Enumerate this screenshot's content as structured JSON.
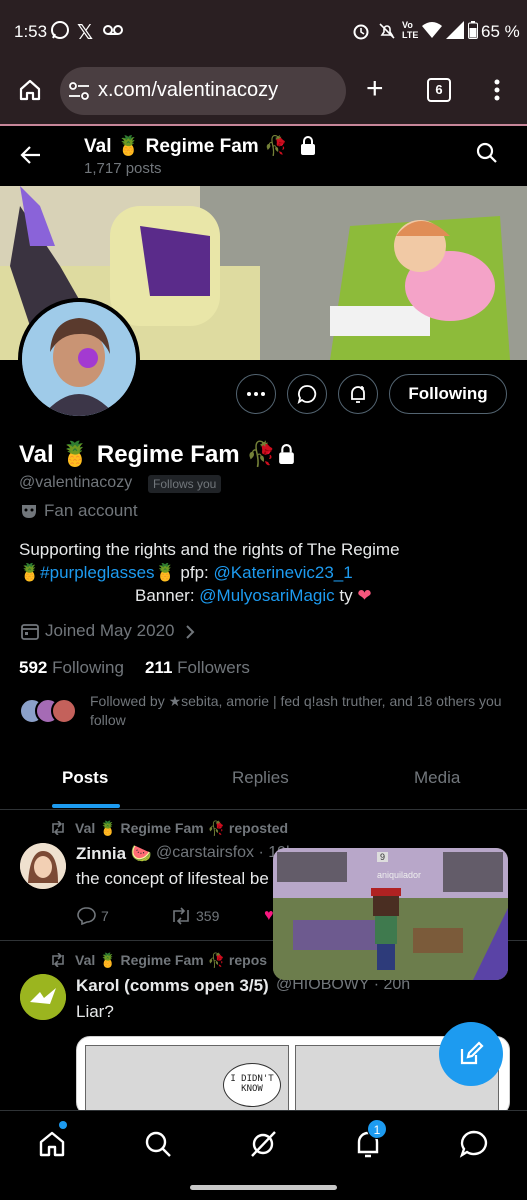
{
  "status": {
    "time": "1:53",
    "battery": "65 %",
    "volte": "Vo LTE"
  },
  "browser": {
    "url": "x.com/valentinacozy",
    "tab_count": "6"
  },
  "header": {
    "name": "Val 🍍 Regime Fam 🥀",
    "posts": "1,717 posts"
  },
  "profile": {
    "name": "Val 🍍 Regime Fam 🥀",
    "handle": "@valentinacozy",
    "follows_you": "Follows you",
    "account_type": "Fan account",
    "bio_line1": "Supporting the rights and the rights of The Regime",
    "bio_hashtag": "#purpleglasses",
    "bio_pfp": "pfp:",
    "bio_pfp_handle": "@Katerinevic23_1",
    "bio_banner": "Banner:",
    "bio_banner_handle": "@MulyosariMagic",
    "bio_ty": "ty",
    "joined": "Joined May 2020",
    "following_count": "592",
    "following_label": "Following",
    "followers_count": "211",
    "followers_label": "Followers",
    "followed_by": "Followed by ★sebita, amorie | fed q!ash truther, and 18 others you follow"
  },
  "actions": {
    "following_button": "Following"
  },
  "tabs": [
    "Posts",
    "Replies",
    "Media"
  ],
  "tweets": [
    {
      "repost_label": "Val 🍍 Regime Fam 🥀 reposted",
      "name": "Zinnia 🍉",
      "handle": "@carstairsfox · 19h",
      "text": "the concept of lifesteal be",
      "replies": "7",
      "reposts": "359"
    },
    {
      "repost_label": "Val 🍍 Regime Fam 🥀 repos",
      "name": "Karol (comms open 3/5)",
      "handle": "@HIOBOWY · 20h",
      "text": "Liar?",
      "comic_text": "I DIDN'T KNOW"
    }
  ],
  "video": {
    "overlay_name": "aniquilador",
    "badge": "9"
  },
  "nav": {
    "notif_count": "1"
  },
  "colors": {
    "accent": "#1d9bf0",
    "bg": "#000000",
    "statusbar": "#2a1f22"
  }
}
